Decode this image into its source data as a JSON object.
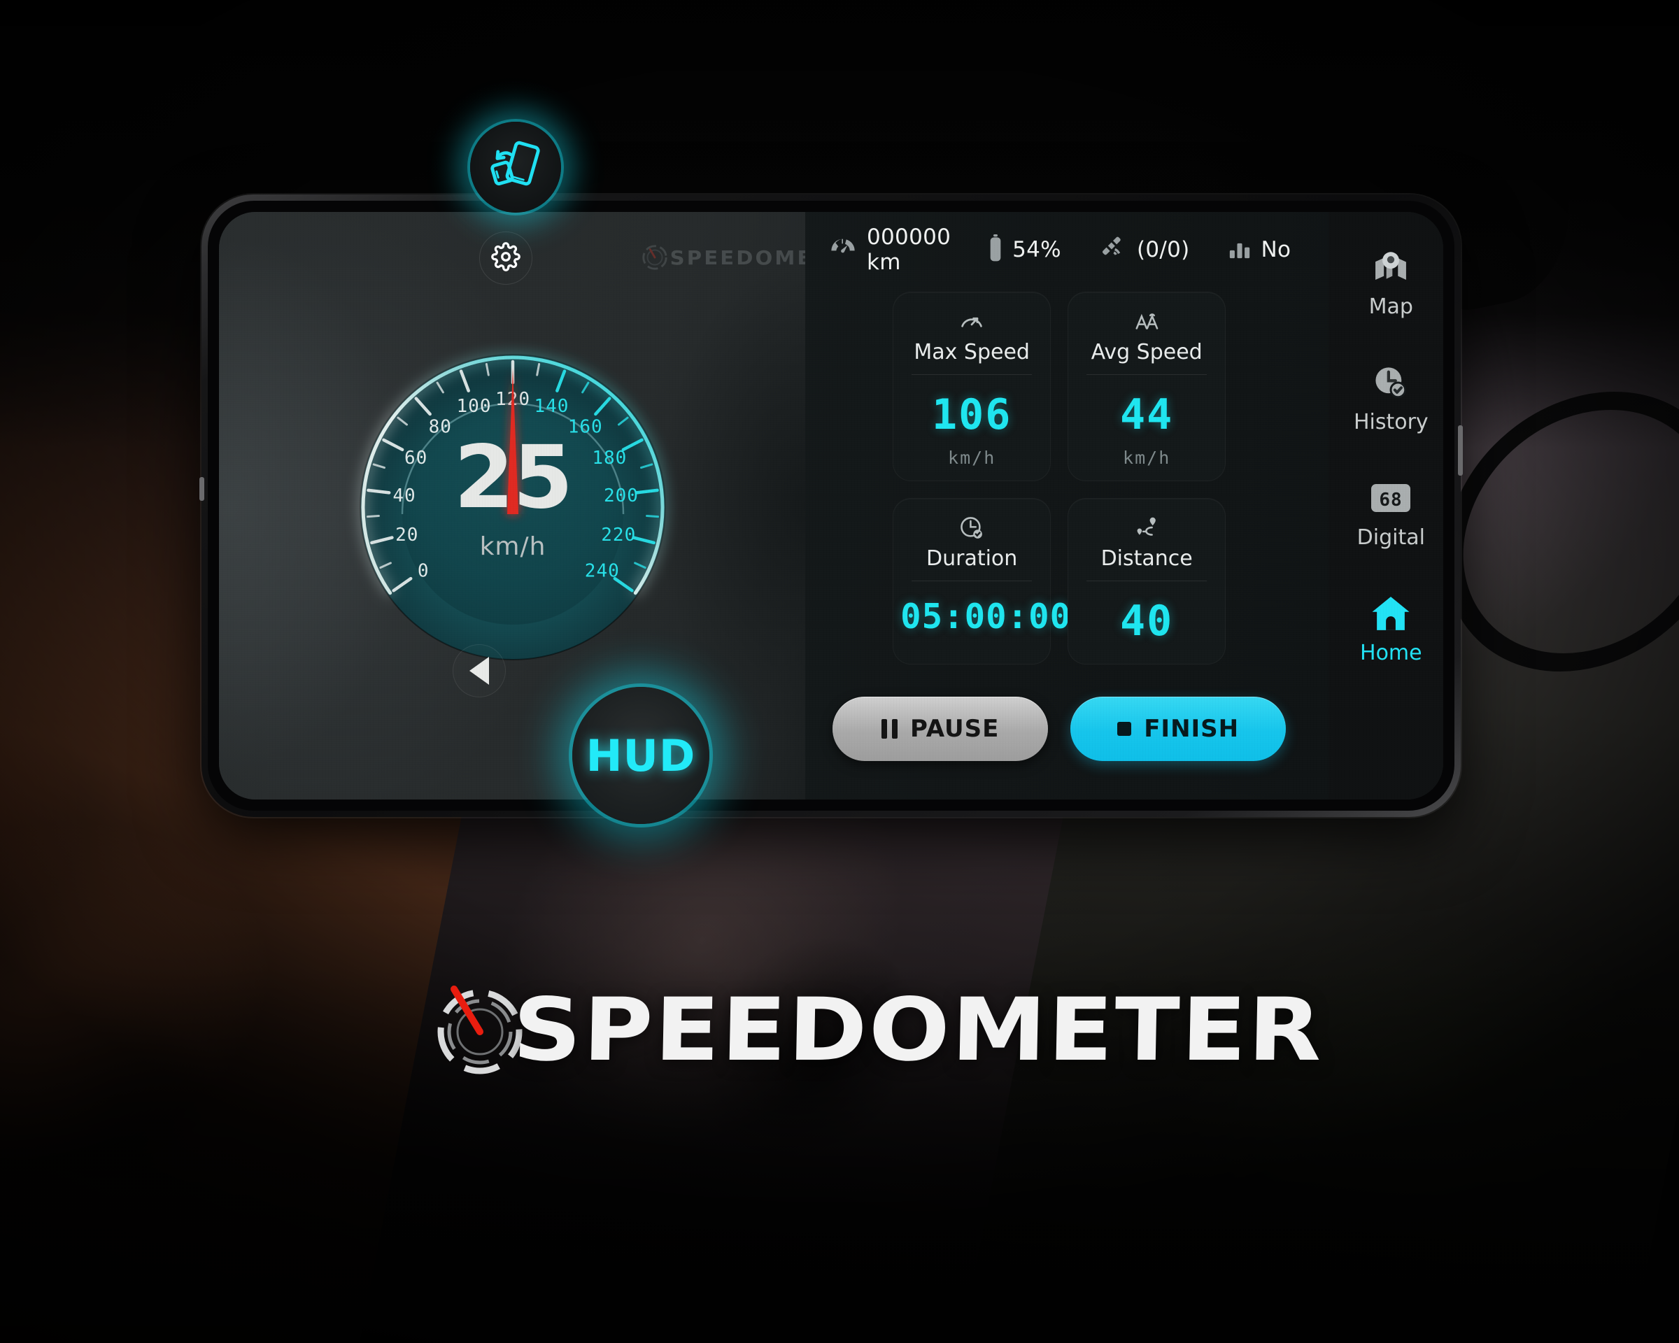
{
  "app": {
    "name": "SPEEDOMETER",
    "header_logo_text": "SPEEDOMETER",
    "brand_wordmark": "SPEEDOMETER"
  },
  "badges": {
    "rotate": {
      "icon": "rotate-device-icon",
      "label": ""
    },
    "hud": {
      "label": "HUD"
    }
  },
  "topbar": {
    "settings_icon": "gear-icon"
  },
  "statusbar": [
    {
      "icon": "odometer-icon",
      "value": "000000 km"
    },
    {
      "icon": "battery-icon",
      "value": "54%"
    },
    {
      "icon": "satellite-icon",
      "value": "(0/0)"
    },
    {
      "icon": "signal-bars-icon",
      "value": "No"
    }
  ],
  "gauge": {
    "value": "25",
    "unit": "km/h",
    "needle_value": 120,
    "prev_icon": "chevron-left-icon",
    "next_icon": "chevron-right-icon"
  },
  "chart_data": {
    "type": "gauge",
    "title": "Speedometer dial",
    "value": 25,
    "needle_value": 120,
    "unit": "km/h",
    "min": 0,
    "max": 240,
    "major_tick_step": 20,
    "minor_ticks_per_major": 2,
    "tick_labels": [
      0,
      20,
      40,
      60,
      80,
      100,
      120,
      140,
      160,
      180,
      200,
      220,
      240
    ],
    "tick_label_colors": {
      "low_range": "#dfe8e8",
      "high_range": "#28e0e8"
    },
    "arc_start_angle_deg": -125,
    "arc_end_angle_deg": 125,
    "needle_color": "#e02b20",
    "dial_fill": "#12494f",
    "grid": false,
    "legend": false
  },
  "cards": [
    {
      "icon": "max-speed-icon",
      "label": "Max Speed",
      "value": "106",
      "unit": "km/h"
    },
    {
      "icon": "avg-speed-icon",
      "label": "Avg Speed",
      "value": "44",
      "unit": "km/h"
    },
    {
      "icon": "duration-icon",
      "label": "Duration",
      "value": "05:00:00",
      "unit": ""
    },
    {
      "icon": "distance-icon",
      "label": "Distance",
      "value": "40",
      "unit": ""
    }
  ],
  "actions": {
    "pause_label": "PAUSE",
    "finish_label": "FINISH"
  },
  "nav": [
    {
      "icon": "map-pin-icon",
      "label": "Map",
      "active": false
    },
    {
      "icon": "clock-check-icon",
      "label": "History",
      "active": false
    },
    {
      "icon": "digital-68-icon",
      "label": "Digital",
      "active": false
    },
    {
      "icon": "home-icon",
      "label": "Home",
      "active": true
    }
  ],
  "colors": {
    "accent_cyan": "#22e3f5",
    "digit_cyan": "#1fe6f0",
    "needle_red": "#e02b20",
    "screen_bg": "#1d2022",
    "rail_bg": "#101213"
  }
}
